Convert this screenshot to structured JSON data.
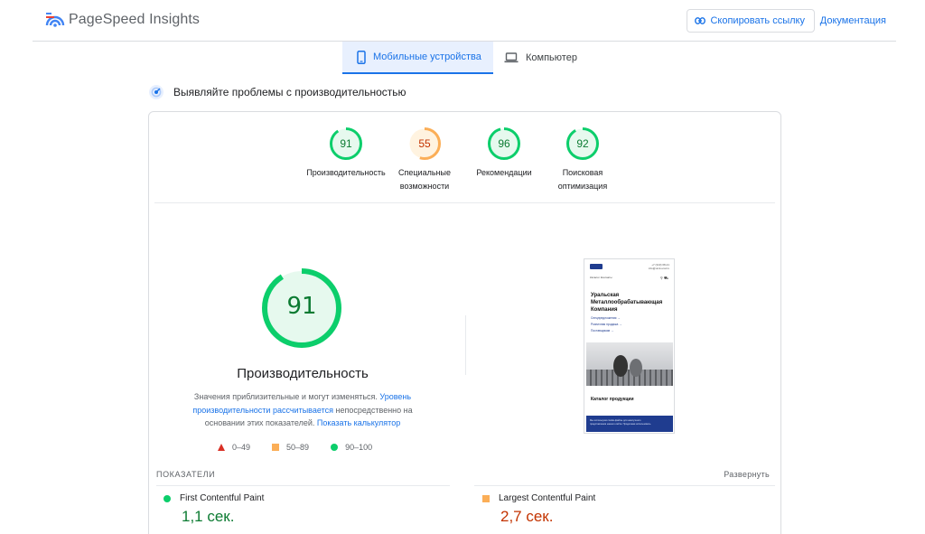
{
  "header": {
    "app_title": "PageSpeed Insights",
    "copy_link_label": "Скопировать ссылку",
    "docs_label": "Документация"
  },
  "tabs": [
    {
      "label": "Мобильные устройства",
      "icon": "phone-icon",
      "active": true
    },
    {
      "label": "Компьютер",
      "icon": "laptop-icon",
      "active": false
    }
  ],
  "section": {
    "title": "Выявляйте проблемы с производительностью",
    "icon": "gauge-icon"
  },
  "categories": [
    {
      "score": "91",
      "label_line1": "Производительность",
      "label_line2": "",
      "color": "#0cce6b",
      "text_color": "#0c7b32",
      "fraction": 0.91
    },
    {
      "score": "55",
      "label_line1": "Специальные",
      "label_line2": "возможности",
      "color": "#fbae57",
      "text_color": "#c33300",
      "fraction": 0.55
    },
    {
      "score": "96",
      "label_line1": "Рекомендации",
      "label_line2": "",
      "color": "#0cce6b",
      "text_color": "#0c7b32",
      "fraction": 0.96
    },
    {
      "score": "92",
      "label_line1": "Поисковая",
      "label_line2": "оптимизация",
      "color": "#0cce6b",
      "text_color": "#0c7b32",
      "fraction": 0.92
    }
  ],
  "performance": {
    "score": "91",
    "fraction": 0.91,
    "title": "Производительность",
    "desc_part1": "Значения приблизительные и могут изменяться. ",
    "desc_link1": "Уровень производительности рассчитывается",
    "desc_part2": " непосредственно на основании этих показателей. ",
    "desc_link2": "Показать калькулятор"
  },
  "legend": [
    {
      "range": "0–49",
      "shape": "triangle",
      "color": "#d93025"
    },
    {
      "range": "50–89",
      "shape": "square",
      "color": "#fbae57"
    },
    {
      "range": "90–100",
      "shape": "circle",
      "color": "#0cce6b"
    }
  ],
  "preview": {
    "nav_left": "Каталог   Контакты",
    "contact_line1": "+7 (343) 68-21",
    "contact_line2": "info@umk-ural.ru",
    "heading_line1": "Уральская",
    "heading_line2": "Металлообрабатывающая",
    "heading_line3": "Компания",
    "link1": "Спецпредложения →",
    "link2": "Розничная продажа →",
    "link3": "Поставщикам →",
    "catalog": "Каталог продукции",
    "footer_line1": "Мы используем cookie-файлы для наилучшего",
    "footer_line2": "представления нашего сайта. Продолжая использовать"
  },
  "metrics": {
    "label": "ПОКАЗАТЕЛИ",
    "expand_label": "Развернуть",
    "items": [
      {
        "name": "First Contentful Paint",
        "value": "1,1 сек.",
        "status": "good",
        "color": "#0c7b32"
      },
      {
        "name": "Largest Contentful Paint",
        "value": "2,7 сек.",
        "status": "average",
        "color": "#c33300"
      }
    ]
  }
}
